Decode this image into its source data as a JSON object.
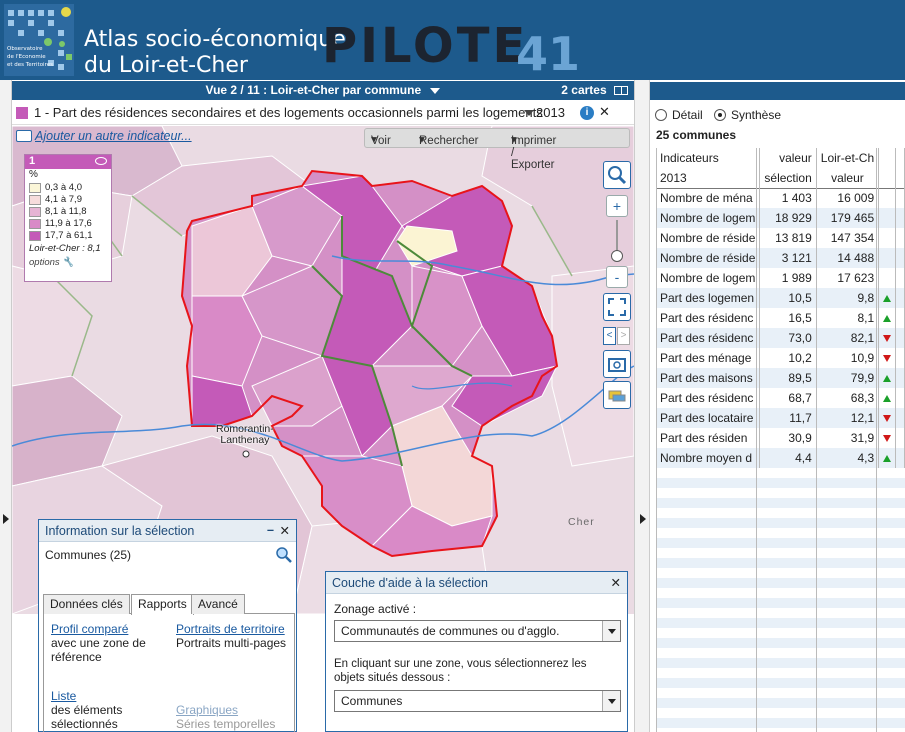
{
  "header": {
    "title_line1": "Atlas socio-économique",
    "title_line2": "du Loir-et-Cher",
    "brand": "PILOTE",
    "brand_number": "41",
    "logo_text_1": "Observatoire",
    "logo_text_2": "de l'Economie",
    "logo_text_3": "et des Territoires"
  },
  "view": {
    "title": "Vue 2 / 11 : Loir-et-Cher par commune",
    "maps_label": "2 cartes"
  },
  "indicator": {
    "label": "1 - Part des résidences secondaires et des logements occasionnels parmi les logements",
    "year": "2013",
    "add_link": "Ajouter un autre indicateur..."
  },
  "map_toolbar": {
    "voir": "Voir",
    "rechercher": "Rechercher",
    "imprimer": "Imprimer / Exporter"
  },
  "legend": {
    "number": "1",
    "unit": "%",
    "classes": [
      {
        "label": "0,3 à 4,0",
        "color": "#fbf6d8"
      },
      {
        "label": "4,1 à 7,9",
        "color": "#f6dcdc"
      },
      {
        "label": "8,1 à 11,8",
        "color": "#e6b4d4"
      },
      {
        "label": "11,9 à 17,6",
        "color": "#d98ac7"
      },
      {
        "label": "17,7 à 61,1",
        "color": "#c45ab8"
      }
    ],
    "reference": "Loir-et-Cher : 8,1",
    "options": "options"
  },
  "map_labels": {
    "city_line1": "Romorantin-",
    "city_line2": "Lanthenay",
    "river": "Cher"
  },
  "info_panel": {
    "title": "Information sur la sélection",
    "communes": "Communes (25)",
    "tabs": [
      "Données clés",
      "Rapports",
      "Avancé"
    ],
    "profil_link": "Profil comparé",
    "profil_desc_1": "avec une zone de",
    "profil_desc_2": "référence",
    "portraits_link": "Portraits de territoire",
    "portraits_desc": "Portraits multi-pages",
    "liste_link": "Liste",
    "liste_desc_1": "des éléments",
    "liste_desc_2": "sélectionnés",
    "graph_link": "Graphiques",
    "graph_desc": "Séries temporelles"
  },
  "help_panel": {
    "title": "Couche d'aide à la sélection",
    "zonage_label": "Zonage activé :",
    "zonage_value": "Communautés de communes ou d'agglo.",
    "hint_1": "En cliquant sur une zone, vous sélectionnerez les",
    "hint_2": "objets situés dessous :",
    "objets_value": "Communes"
  },
  "right": {
    "detail": "Détail",
    "synthese": "Synthèse",
    "count": "25 communes",
    "col_indicateurs": "Indicateurs",
    "col_year": "2013",
    "col_valeur": "valeur",
    "col_selection": "sélection",
    "col_ref": "Loir-et-Ch",
    "col_ref_valeur": "valeur",
    "rows": [
      {
        "name": "Nombre de ména",
        "sel": "1 403",
        "ref": "16 009",
        "trend": ""
      },
      {
        "name": "Nombre de logem",
        "sel": "18 929",
        "ref": "179 465",
        "trend": ""
      },
      {
        "name": "Nombre de réside",
        "sel": "13 819",
        "ref": "147 354",
        "trend": ""
      },
      {
        "name": "Nombre de réside",
        "sel": "3 121",
        "ref": "14 488",
        "trend": ""
      },
      {
        "name": "Nombre de logem",
        "sel": "1 989",
        "ref": "17 623",
        "trend": ""
      },
      {
        "name": "Part des logemen",
        "sel": "10,5",
        "ref": "9,8",
        "trend": "up"
      },
      {
        "name": "Part des résidenc",
        "sel": "16,5",
        "ref": "8,1",
        "trend": "up"
      },
      {
        "name": "Part des résidenc",
        "sel": "73,0",
        "ref": "82,1",
        "trend": "down"
      },
      {
        "name": "Part des ménage",
        "sel": "10,2",
        "ref": "10,9",
        "trend": "down"
      },
      {
        "name": "Part des maisons",
        "sel": "89,5",
        "ref": "79,9",
        "trend": "up"
      },
      {
        "name": "Part des résidenc",
        "sel": "68,7",
        "ref": "68,3",
        "trend": "up"
      },
      {
        "name": "Part des locataire",
        "sel": "11,7",
        "ref": "12,1",
        "trend": "down"
      },
      {
        "name": "Part des résiden",
        "sel": "30,9",
        "ref": "31,9",
        "trend": "down"
      },
      {
        "name": "Nombre moyen d",
        "sel": "4,4",
        "ref": "4,3",
        "trend": "up"
      }
    ]
  }
}
